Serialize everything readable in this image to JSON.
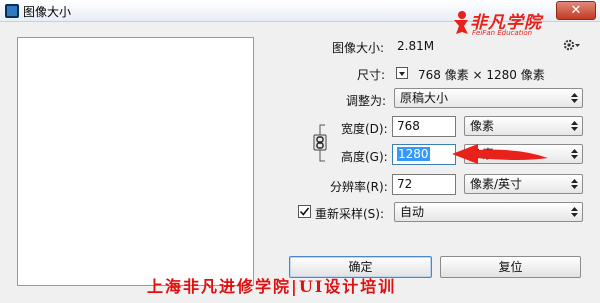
{
  "window": {
    "title": "图像大小",
    "close_glyph": "✕"
  },
  "logo": {
    "main": "非凡学院",
    "sub": "FeiFan Education",
    "color": "#e8211a"
  },
  "image_size": {
    "label": "图像大小:",
    "value": "2.81M"
  },
  "dimensions": {
    "label": "尺寸:",
    "value": "768 像素  ×  1280 像素"
  },
  "fit_to": {
    "label": "调整为:",
    "value": "原稿大小"
  },
  "width": {
    "label": "宽度(D):",
    "value": "768",
    "unit": "像素"
  },
  "height": {
    "label": "高度(G):",
    "value": "1280",
    "unit": "像素"
  },
  "resolution": {
    "label": "分辨率(R):",
    "value": "72",
    "unit": "像素/英寸"
  },
  "resample": {
    "label": "重新采样(S):",
    "value": "自动",
    "checked": true
  },
  "buttons": {
    "ok": "确定",
    "reset": "复位"
  },
  "watermark": {
    "text": "上海非凡进修学院|UI设计培训",
    "color": "#e01010"
  },
  "icons": {
    "gear": "gear-icon",
    "link": "link-chain-icon",
    "dropdown": "dropdown-arrows-icon"
  },
  "colors": {
    "selection": "#3399ff",
    "annotation_arrow": "#e8211a"
  }
}
